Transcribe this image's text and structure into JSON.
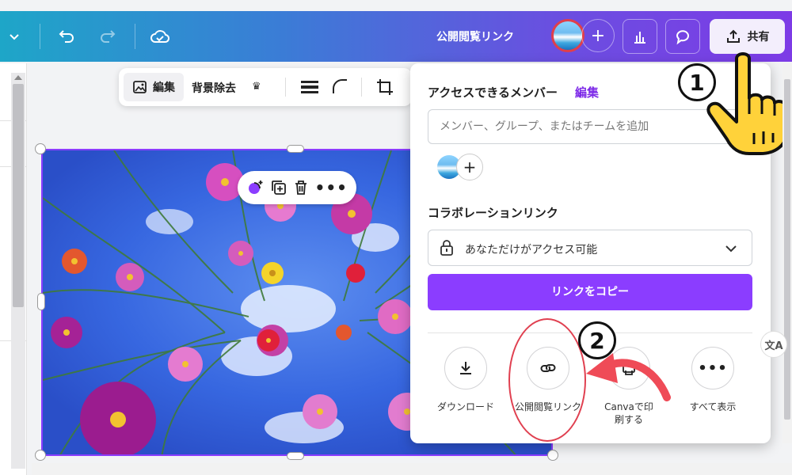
{
  "topbar": {
    "public_link_title": "公開閲覧リンク",
    "share_label": "共有"
  },
  "edit_toolbar": {
    "edit_label": "編集",
    "bg_remove_label": "背景除去"
  },
  "share_panel": {
    "access_members_title": "アクセスできるメンバー",
    "edit_link": "編集",
    "member_input_placeholder": "メンバー、グループ、またはチームを追加",
    "collab_link_title": "コラボレーションリンク",
    "access_select_value": "あなただけがアクセス可能",
    "copy_link_button": "リンクをコピー",
    "options": [
      {
        "label": "ダウンロード",
        "icon": "download-icon"
      },
      {
        "label": "公開閲覧リンク",
        "icon": "link-icon"
      },
      {
        "label": "Canvaで印刷する",
        "icon": "print-icon"
      },
      {
        "label": "すべて表示",
        "icon": "more-icon"
      }
    ]
  },
  "annotations": {
    "step1": "1",
    "step2": "2"
  },
  "colors": {
    "accent": "#8b3dff",
    "highlight_red": "#e04050",
    "arrow_red": "#ef4b57",
    "hand_yellow": "#ffd23a"
  }
}
